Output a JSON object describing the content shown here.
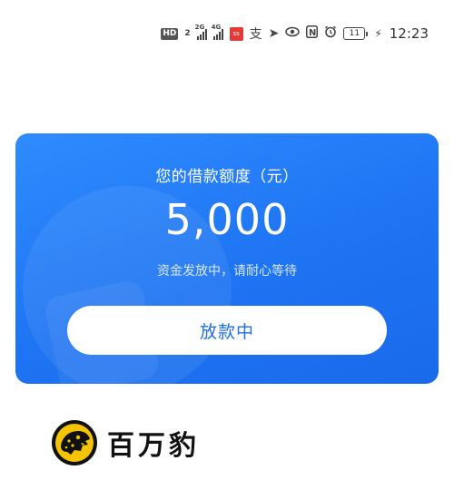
{
  "status_bar": {
    "hd": "HD",
    "sim1_label": "2",
    "net1": "2G",
    "net2": "4G",
    "app_badge": "ss",
    "alipay_glyph": "支",
    "nfc": "N",
    "battery": "11",
    "time": "12:23"
  },
  "card": {
    "title": "您的借款额度（元）",
    "amount": "5,000",
    "subtitle": "资金发放中，请耐心等待",
    "button_label": "放款中",
    "colors": {
      "card_gradient_start": "#2f8bff",
      "card_gradient_end": "#1a6aeb",
      "button_text": "#1f6fe5"
    }
  },
  "brand": {
    "name": "百万豹",
    "logo_icon": "leopard-logo-icon"
  }
}
